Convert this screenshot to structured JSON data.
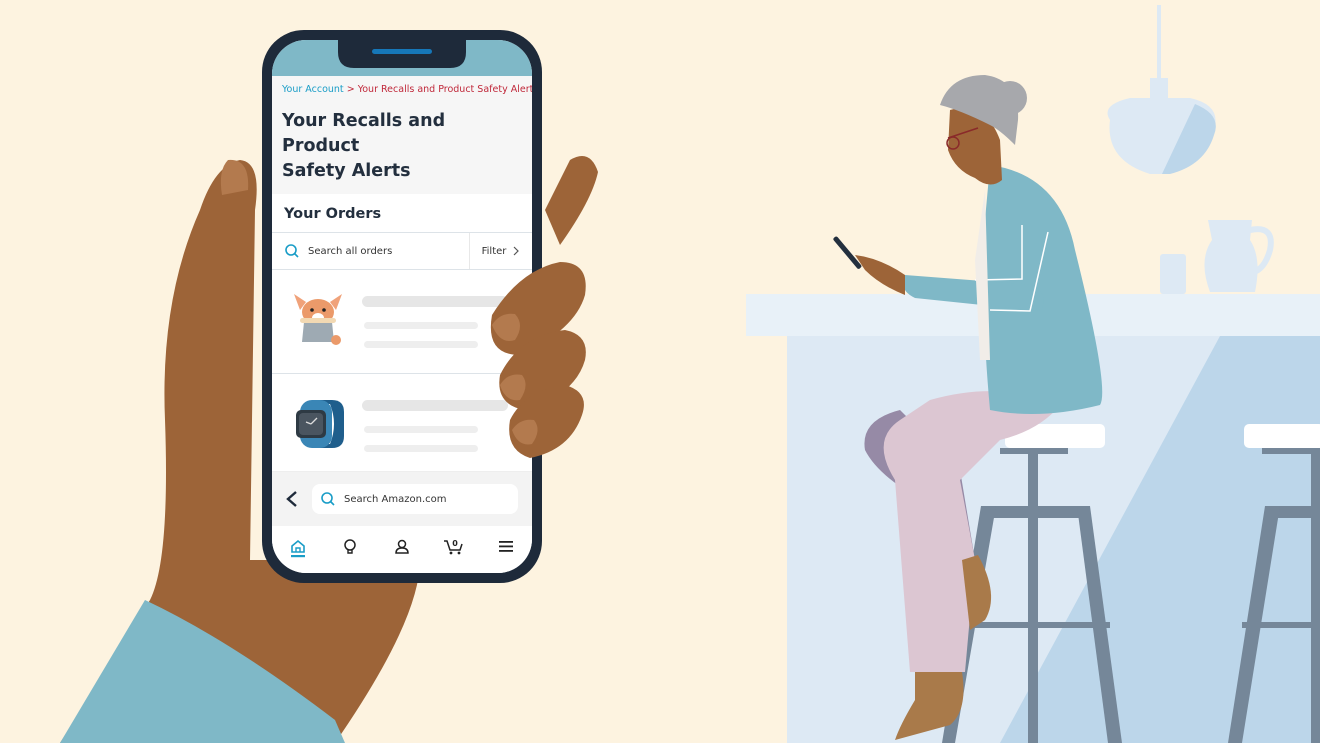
{
  "breadcrumb": {
    "parent": "Your Account",
    "separator": ">",
    "current": "Your Recalls and Product Safety Alerts"
  },
  "page": {
    "title_line1": "Your Recalls and Product",
    "title_line2": "Safety Alerts"
  },
  "orders": {
    "title": "Your Orders",
    "search_placeholder": "Search all orders",
    "filter_label": "Filter",
    "items": [
      {
        "icon": "corgi-plush-icon"
      },
      {
        "icon": "smartwatch-icon"
      }
    ]
  },
  "bottom_search": {
    "placeholder": "Search Amazon.com"
  },
  "bottom_nav": {
    "items": [
      {
        "icon": "home-icon",
        "active": true
      },
      {
        "icon": "lightbulb-icon",
        "active": false
      },
      {
        "icon": "account-icon",
        "active": false
      },
      {
        "icon": "cart-icon",
        "active": false,
        "count": "0"
      },
      {
        "icon": "menu-icon",
        "active": false
      }
    ]
  },
  "colors": {
    "background": "#fdf3e0",
    "accent": "#1a9dc7",
    "alert_red": "#c0283a",
    "heading": "#232f3e",
    "phone_frame": "#1e2a3a",
    "sleeve": "#7fb8c7",
    "skin": "#9d6438"
  }
}
